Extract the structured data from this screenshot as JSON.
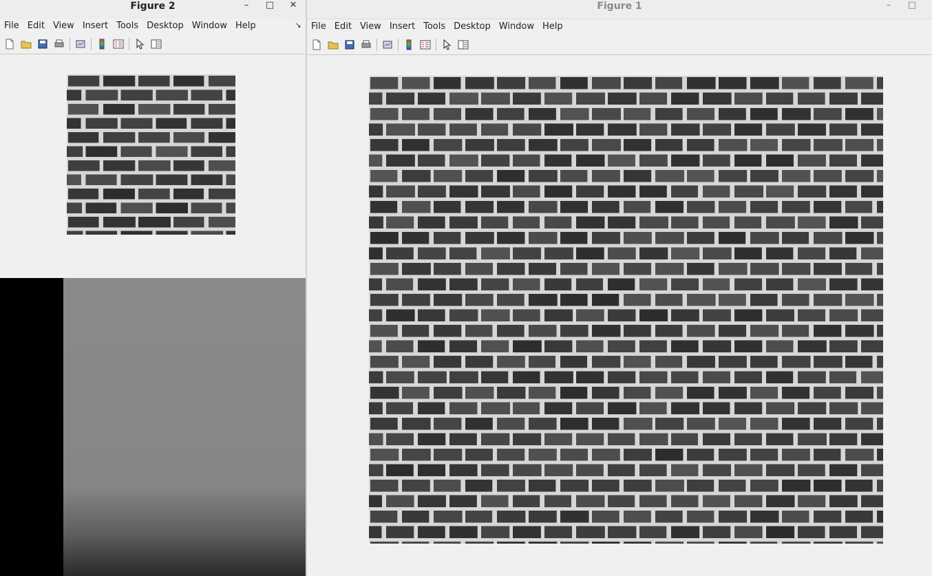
{
  "figure2": {
    "title": "Figure 2",
    "controls": {
      "minimize": "–",
      "maximize": "□",
      "close": "✕",
      "dock": "↘"
    },
    "menu": [
      "File",
      "Edit",
      "View",
      "Insert",
      "Tools",
      "Desktop",
      "Window",
      "Help"
    ],
    "menu_mnemonics": [
      "F",
      "E",
      "V",
      "I",
      "T",
      "D",
      "W",
      "H"
    ],
    "toolbar": [
      "new-figure-icon",
      "open-file-icon",
      "save-icon",
      "print-icon",
      "link-plot-icon",
      "colorbar-icon",
      "legend-icon",
      "select-pointer-icon",
      "property-editor-icon"
    ]
  },
  "figure1": {
    "title": "Figure 1",
    "controls": {
      "minimize": "–",
      "maximize": "□"
    },
    "menu": [
      "File",
      "Edit",
      "View",
      "Insert",
      "Tools",
      "Desktop",
      "Window",
      "Help"
    ],
    "menu_mnemonics": [
      "F",
      "E",
      "V",
      "I",
      "T",
      "D",
      "W",
      "H"
    ],
    "toolbar": [
      "new-figure-icon",
      "open-file-icon",
      "save-icon",
      "print-icon",
      "link-plot-icon",
      "colorbar-icon",
      "legend-icon",
      "select-pointer-icon",
      "property-editor-icon"
    ]
  },
  "images": {
    "source_texture": "brick-wall-grayscale",
    "synthesized_texture": "brick-wall-grayscale-quilted"
  },
  "colors": {
    "window_bg": "#f0f0f0",
    "mortar": "#d8d8d8",
    "brick": "#424242"
  }
}
